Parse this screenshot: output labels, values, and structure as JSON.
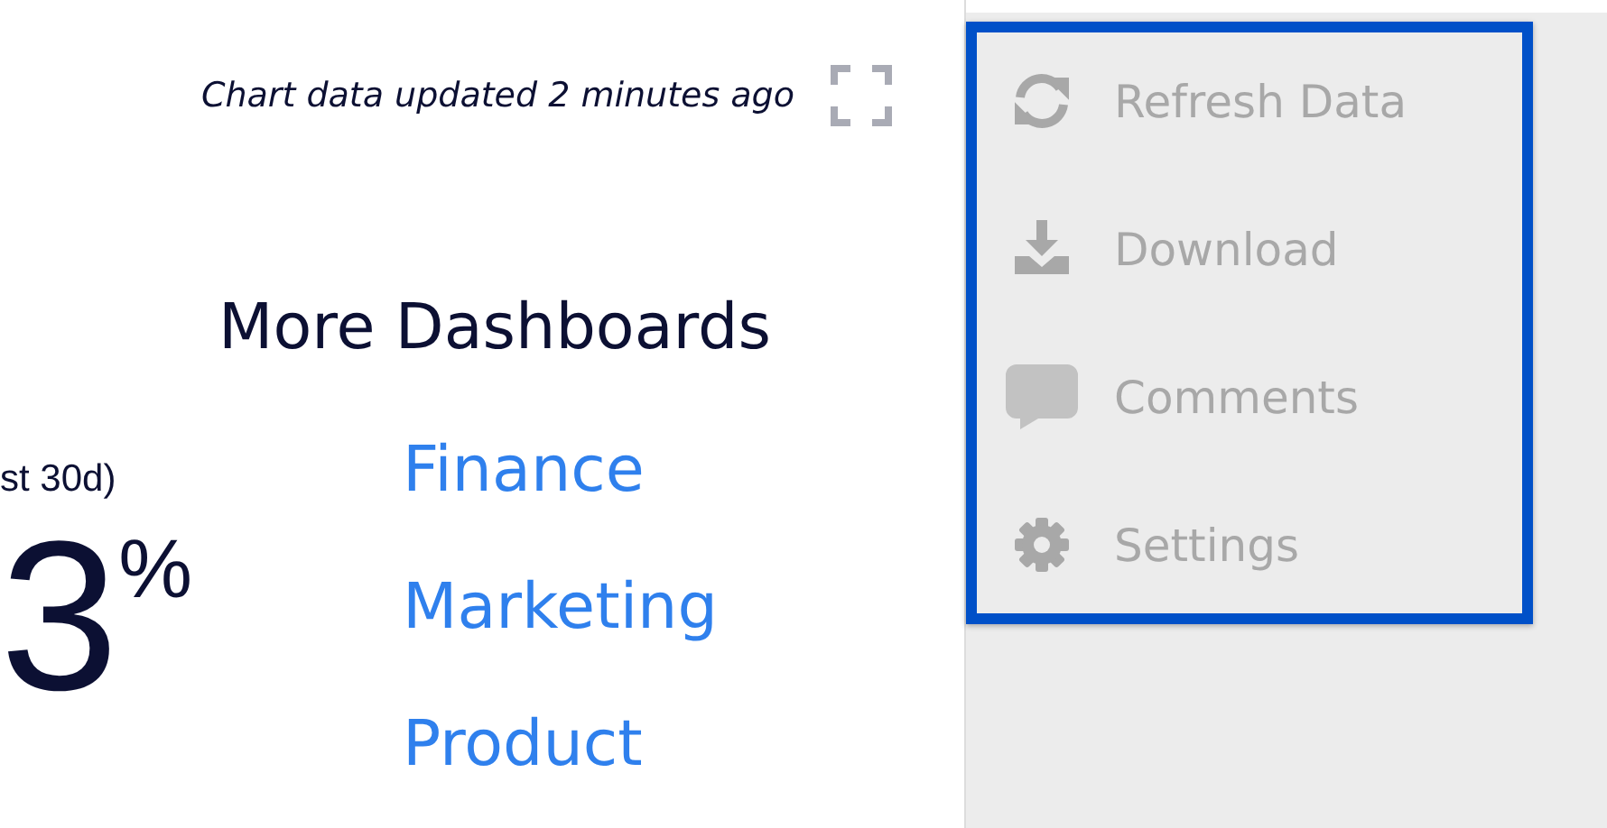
{
  "header": {
    "updated_text": "Chart data updated 2 minutes ago"
  },
  "stat": {
    "label": "st 30d)",
    "value": "3",
    "unit": "%"
  },
  "more_dashboards": {
    "title": "More Dashboards",
    "links": [
      "Finance",
      "Marketing",
      "Product"
    ]
  },
  "menu": {
    "items": [
      {
        "kind": "refresh",
        "label": "Refresh Data"
      },
      {
        "kind": "download",
        "label": "Download"
      },
      {
        "kind": "comments",
        "label": "Comments"
      },
      {
        "kind": "settings",
        "label": "Settings"
      }
    ]
  }
}
